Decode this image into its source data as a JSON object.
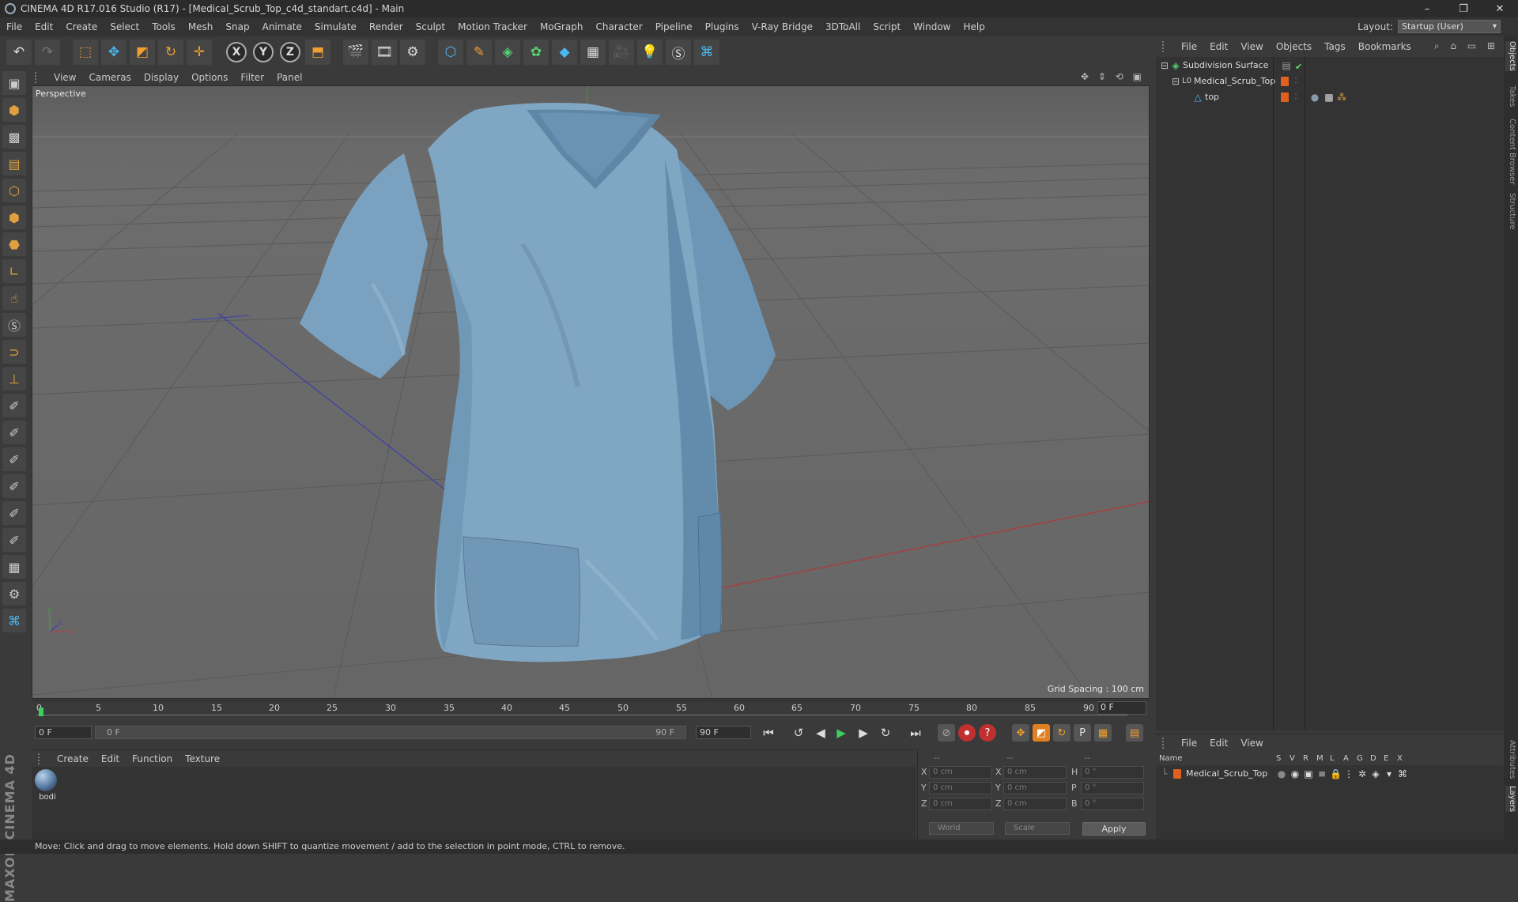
{
  "window": {
    "title": "CINEMA 4D R17.016 Studio (R17) - [Medical_Scrub_Top_c4d_standart.c4d] - Main",
    "controls": [
      "–",
      "❐",
      "✕"
    ]
  },
  "menu": [
    "File",
    "Edit",
    "Create",
    "Select",
    "Tools",
    "Mesh",
    "Snap",
    "Animate",
    "Simulate",
    "Render",
    "Sculpt",
    "Motion Tracker",
    "MoGraph",
    "Character",
    "Pipeline",
    "Plugins",
    "V-Ray Bridge",
    "3DToAll",
    "Script",
    "Window",
    "Help"
  ],
  "layout": {
    "label": "Layout:",
    "value": "Startup (User)"
  },
  "toolbar": {
    "icons": [
      "undo-icon",
      "redo-icon",
      "live-selection-icon",
      "move-icon",
      "scale-icon",
      "rotate-icon",
      "transform-icon",
      "x-axis-icon",
      "y-axis-icon",
      "z-axis-icon",
      "world-coordinates-icon",
      "render-view-icon",
      "render-picture-viewer-icon",
      "edit-render-settings-icon",
      "cube-icon",
      "pen-spline-icon",
      "subdivision-surface-icon",
      "cloner-icon",
      "deformer-icon",
      "floor-icon",
      "camera-icon",
      "light-icon",
      "3dtoall-icon",
      "python-icon"
    ],
    "axes": [
      "X",
      "Y",
      "Z"
    ]
  },
  "viewport": {
    "menu": [
      "View",
      "Cameras",
      "Display",
      "Options",
      "Filter",
      "Panel"
    ],
    "label": "Perspective",
    "grid_spacing": "Grid Spacing : 100 cm",
    "object_color": "#7fa6c2"
  },
  "timeline": {
    "ticks": [
      "0",
      "5",
      "10",
      "15",
      "20",
      "25",
      "30",
      "35",
      "40",
      "45",
      "50",
      "55",
      "60",
      "65",
      "70",
      "75",
      "80",
      "85",
      "90"
    ],
    "current_frame": "0 F",
    "start_field": "0 F",
    "slider_start": "0 F",
    "slider_end": "90 F",
    "end_field": "90 F"
  },
  "material_manager": {
    "menu": [
      "Create",
      "Edit",
      "Function",
      "Texture"
    ],
    "materials": [
      {
        "name": "bodi"
      }
    ]
  },
  "coordinates": {
    "header": [
      "--",
      "--",
      "--"
    ],
    "rows": [
      {
        "axis": "X",
        "pos": "0 cm",
        "size_axis": "X",
        "size": "0 cm",
        "rot_axis": "H",
        "rot": "0 °"
      },
      {
        "axis": "Y",
        "pos": "0 cm",
        "size_axis": "Y",
        "size": "0 cm",
        "rot_axis": "P",
        "rot": "0 °"
      },
      {
        "axis": "Z",
        "pos": "0 cm",
        "size_axis": "Z",
        "size": "0 cm",
        "rot_axis": "B",
        "rot": "0 °"
      }
    ],
    "mode": "World",
    "type": "Scale",
    "apply": "Apply"
  },
  "object_manager": {
    "menu": [
      "File",
      "Edit",
      "View",
      "Objects",
      "Tags",
      "Bookmarks"
    ],
    "objects": [
      {
        "name": "Subdivision Surface",
        "level": 0
      },
      {
        "name": "Medical_Scrub_Top",
        "level": 1
      },
      {
        "name": "top",
        "level": 2
      }
    ]
  },
  "layer_manager": {
    "menu": [
      "File",
      "Edit",
      "View"
    ],
    "columns": [
      "Name",
      "S",
      "V",
      "R",
      "M",
      "L",
      "A",
      "G",
      "D",
      "E",
      "X"
    ],
    "layers": [
      {
        "name": "Medical_Scrub_Top",
        "color": "#e06020"
      }
    ]
  },
  "side_tabs": [
    "Objects",
    "Takes",
    "Content Browser",
    "Structure",
    "Attributes",
    "Layers"
  ],
  "brand": "MAXON CINEMA 4D",
  "status": "Move: Click and drag to move elements. Hold down SHIFT to quantize movement / add to the selection in point mode, CTRL to remove."
}
